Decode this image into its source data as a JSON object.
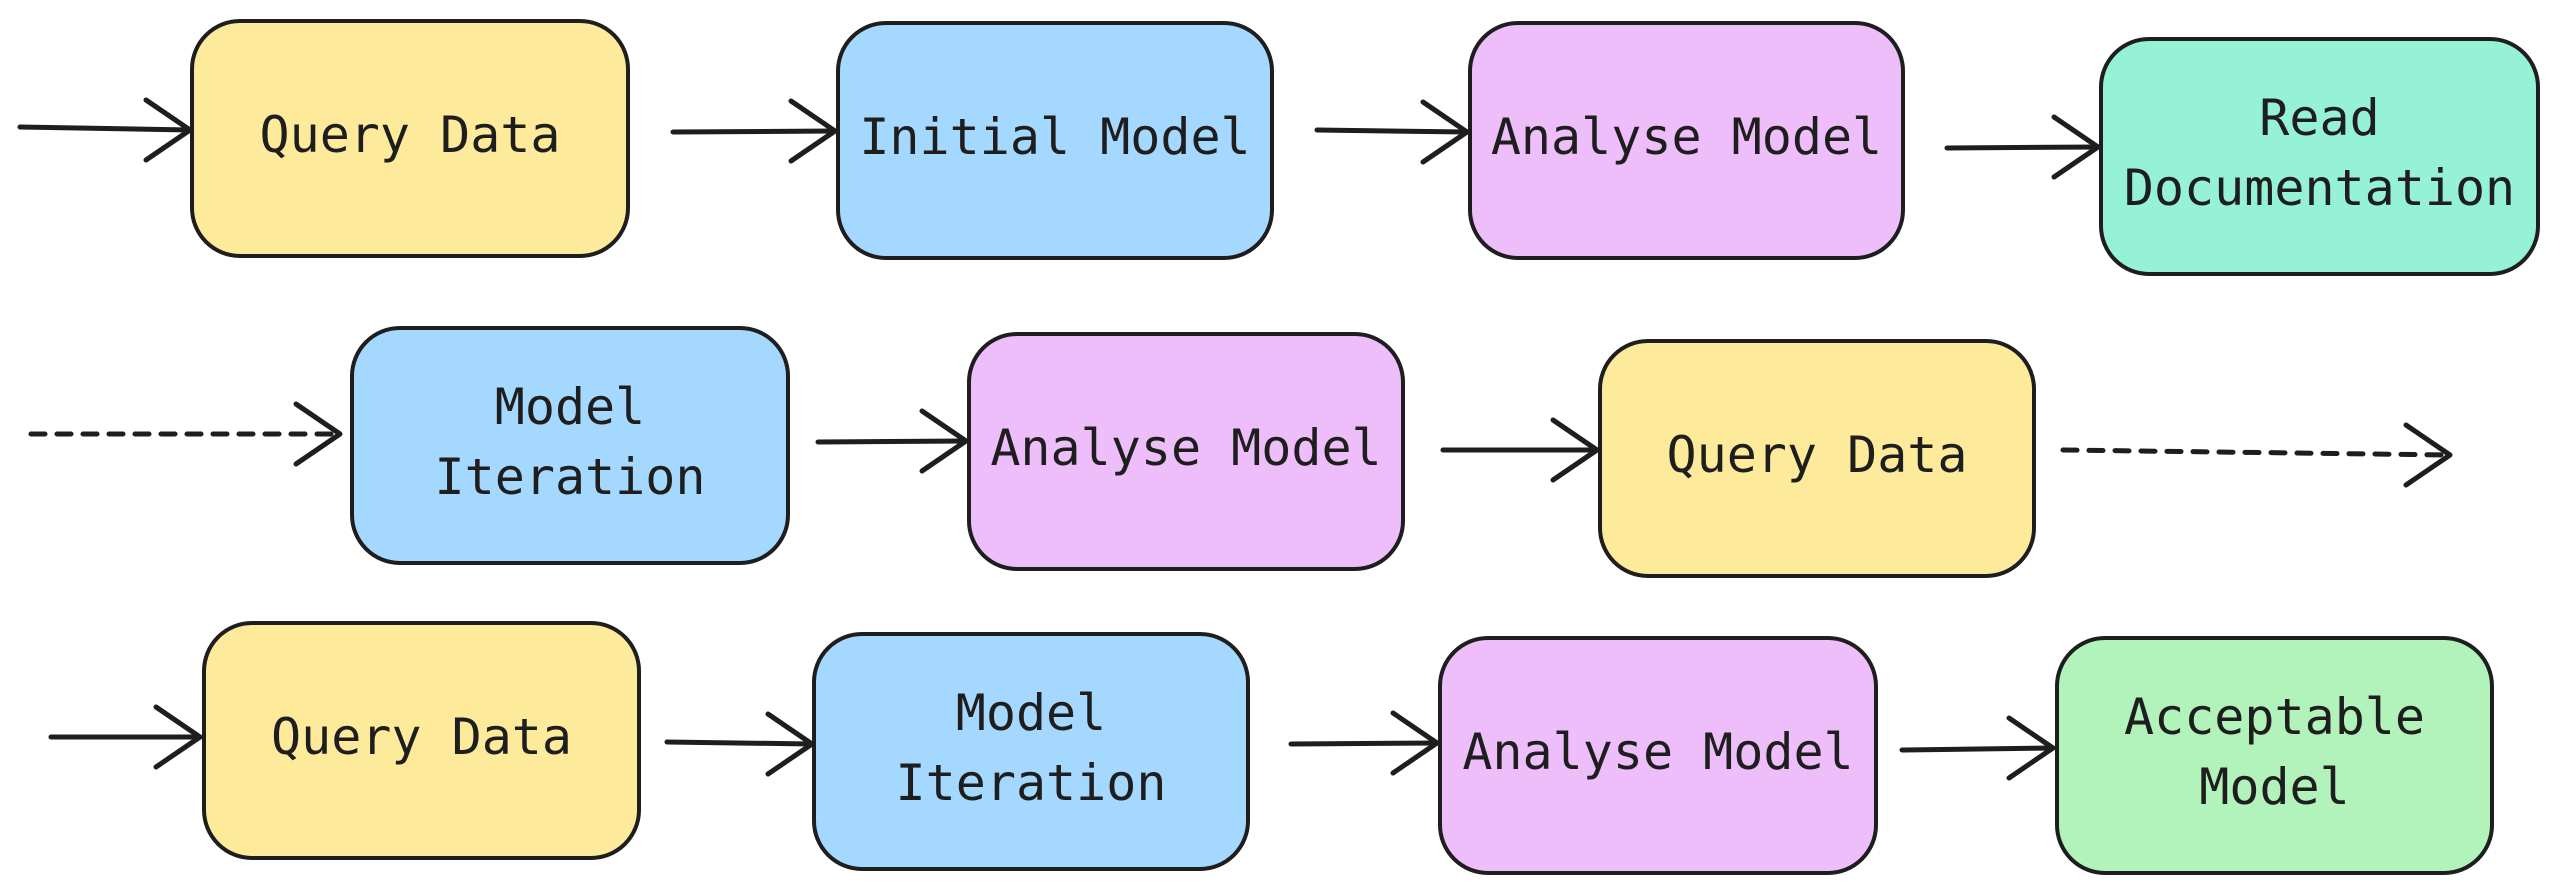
{
  "diagram": {
    "type": "flowchart",
    "colors": {
      "yellow": "#fdea9b",
      "blue": "#a5d8ff",
      "purple": "#eebefa",
      "teal": "#96f2d7",
      "green": "#b2f2bb",
      "stroke": "#1e1e1e"
    },
    "nodes": [
      {
        "id": "r1-query-data",
        "lines": [
          "Query Data"
        ],
        "color": "yellow"
      },
      {
        "id": "r1-initial-model",
        "lines": [
          "Initial Model"
        ],
        "color": "blue"
      },
      {
        "id": "r1-analyse-model",
        "lines": [
          "Analyse Model"
        ],
        "color": "purple"
      },
      {
        "id": "r1-read-documentation",
        "lines": [
          "Read",
          "Documentation"
        ],
        "color": "teal"
      },
      {
        "id": "r2-model-iteration",
        "lines": [
          "Model",
          "Iteration"
        ],
        "color": "blue"
      },
      {
        "id": "r2-analyse-model",
        "lines": [
          "Analyse Model"
        ],
        "color": "purple"
      },
      {
        "id": "r2-query-data",
        "lines": [
          "Query Data"
        ],
        "color": "yellow"
      },
      {
        "id": "r3-query-data",
        "lines": [
          "Query Data"
        ],
        "color": "yellow"
      },
      {
        "id": "r3-model-iteration",
        "lines": [
          "Model",
          "Iteration"
        ],
        "color": "blue"
      },
      {
        "id": "r3-analyse-model",
        "lines": [
          "Analyse Model"
        ],
        "color": "purple"
      },
      {
        "id": "r3-acceptable-model",
        "lines": [
          "Acceptable",
          "Model"
        ],
        "color": "green"
      }
    ],
    "edges": [
      {
        "from": null,
        "to": "r1-query-data",
        "style": "solid"
      },
      {
        "from": "r1-query-data",
        "to": "r1-initial-model",
        "style": "solid"
      },
      {
        "from": "r1-initial-model",
        "to": "r1-analyse-model",
        "style": "solid"
      },
      {
        "from": "r1-analyse-model",
        "to": "r1-read-documentation",
        "style": "solid"
      },
      {
        "from": null,
        "to": "r2-model-iteration",
        "style": "dashed"
      },
      {
        "from": "r2-model-iteration",
        "to": "r2-analyse-model",
        "style": "solid"
      },
      {
        "from": "r2-analyse-model",
        "to": "r2-query-data",
        "style": "solid"
      },
      {
        "from": "r2-query-data",
        "to": null,
        "style": "dashed"
      },
      {
        "from": null,
        "to": "r3-query-data",
        "style": "solid"
      },
      {
        "from": "r3-query-data",
        "to": "r3-model-iteration",
        "style": "solid"
      },
      {
        "from": "r3-model-iteration",
        "to": "r3-analyse-model",
        "style": "solid"
      },
      {
        "from": "r3-analyse-model",
        "to": "r3-acceptable-model",
        "style": "solid"
      }
    ]
  }
}
